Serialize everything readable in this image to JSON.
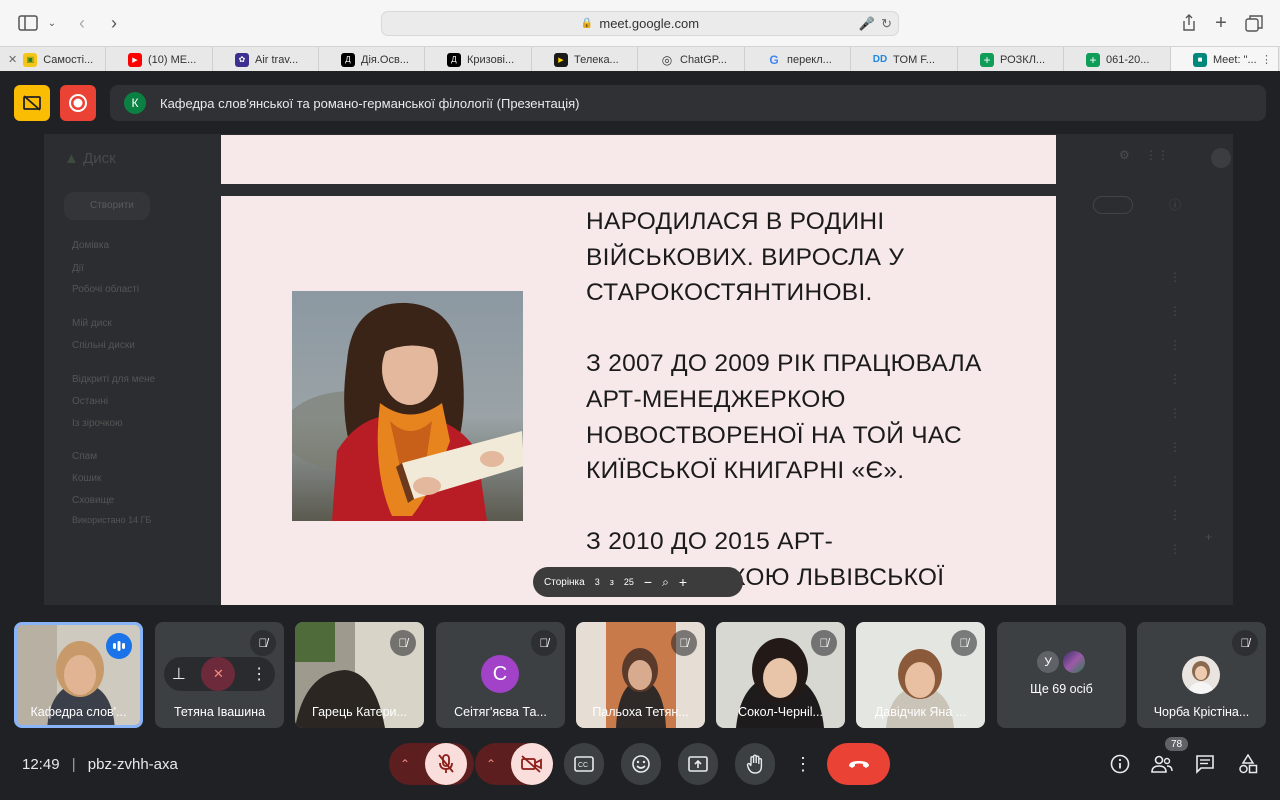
{
  "browser": {
    "url": "meet.google.com",
    "tabs": [
      {
        "label": "Самості...",
        "color": "#f5c518",
        "glyph": "▣"
      },
      {
        "label": "(10) МЕ...",
        "color": "#ff0000",
        "glyph": "▶"
      },
      {
        "label": "Air trav...",
        "color": "#3b2f8f",
        "glyph": "✿"
      },
      {
        "label": "Дія.Осв...",
        "color": "#000000",
        "glyph": "Д"
      },
      {
        "label": "Кризові...",
        "color": "#000000",
        "glyph": "Д"
      },
      {
        "label": "Телека...",
        "color": "#1a1a1a",
        "glyph": "▶"
      },
      {
        "label": "ChatGP...",
        "color": "#444444",
        "glyph": "◎"
      },
      {
        "label": "перекл...",
        "color": "#ffffff",
        "glyph": "G"
      },
      {
        "label": "TOM F...",
        "color": "#1e88e5",
        "glyph": "D"
      },
      {
        "label": "РОЗКЛ...",
        "color": "#0f9d58",
        "glyph": "+"
      },
      {
        "label": "061-20...",
        "color": "#0f9d58",
        "glyph": "+"
      },
      {
        "label": "Meet: \"...",
        "color": "#00897b",
        "glyph": "■"
      }
    ]
  },
  "meeting": {
    "presenter_initial": "К",
    "title": "Кафедра слов'янської та романо-германської філології (Презентація)",
    "time": "12:49",
    "code": "pbz-zvhh-axa",
    "participant_count": "78"
  },
  "drive_ghost": {
    "app": "Диск",
    "create": "Створити",
    "items": [
      "Домівка",
      "Дії",
      "Робочі області",
      "Мій диск",
      "Спільні диски",
      "Відкриті для мене",
      "Останні",
      "Із зірочкою",
      "Спам",
      "Кошик",
      "Сховище",
      "Використано 14 ГБ"
    ]
  },
  "slide": {
    "paragraphs": [
      "НАРОДИЛАСЯ В РОДИНІ ВІЙСЬКОВИХ. ВИРОСЛА У СТАРОКОСТЯНТИНОВІ.",
      "З 2007 ДО 2009 РІК ПРАЦЮВАЛА АРТ-МЕНЕДЖЕРКОЮ НОВОСТВОРЕНОЇ НА ТОЙ ЧАС КИЇВСЬКОЇ КНИГАРНІ «Є».",
      "З 2010 ДО 2015 АРТ-МЕНЕДЖЕРКОЮ ЛЬВІВСЬКОЇ"
    ]
  },
  "pdf_toolbar": {
    "page_label": "Сторінка",
    "page": "3",
    "of": "з",
    "total": "25"
  },
  "participants": [
    {
      "name": "Кафедра слов'...",
      "speaking": true
    },
    {
      "name": "Тетяна Івашина",
      "muted": true
    },
    {
      "name": "Гарець Катери...",
      "muted": true
    },
    {
      "name": "Сеітяг'яєва Та...",
      "muted": true,
      "initial": "С",
      "avatar_color": "#a142c8"
    },
    {
      "name": "Пальоха Тетян...",
      "muted": true
    },
    {
      "name": "Сокол-Чернil...",
      "muted": true
    },
    {
      "name": "Давідчик Яна ...",
      "muted": true
    },
    {
      "name": "Ще 69 осіб",
      "initial": "У"
    },
    {
      "name": "Чорба Крістіна...",
      "muted": true
    }
  ]
}
